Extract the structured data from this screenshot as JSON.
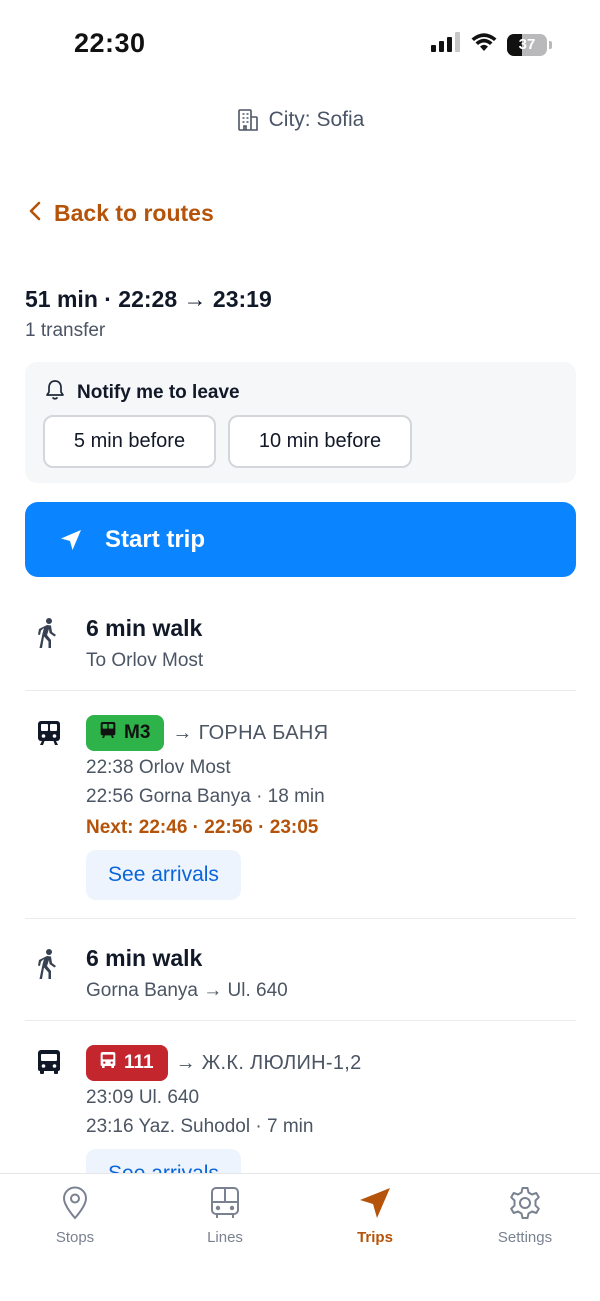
{
  "status_bar": {
    "time": "22:30",
    "battery": "37",
    "battery_level": 0.37
  },
  "header": {
    "city_label": "City: Sofia"
  },
  "back": {
    "label": "Back to routes"
  },
  "trip": {
    "summary": "51 min · 22:28 → 23:19",
    "transfers": "1 transfer"
  },
  "notify": {
    "title": "Notify me to leave",
    "options": [
      "5 min before",
      "10 min before"
    ]
  },
  "start": {
    "label": "Start trip"
  },
  "legs": [
    {
      "type": "walk",
      "title": "6 min walk",
      "subtitle": "To Orlov Most"
    },
    {
      "type": "metro",
      "line": "M3",
      "line_color": "#2eb24a",
      "destination": "→ ГОРНА БАНЯ",
      "departure": "22:38 Orlov Most",
      "arrival": "22:56 Gorna Banya · 18 min",
      "next": "Next: 22:46 · 22:56 · 23:05",
      "see_arrivals": "See arrivals"
    },
    {
      "type": "walk",
      "title": "6 min walk",
      "subtitle": "Gorna Banya → Ul. 640"
    },
    {
      "type": "bus",
      "line": "111",
      "line_color": "#c4262e",
      "destination": "→ Ж.К. ЛЮЛИН-1,2",
      "departure": "23:09 Ul. 640",
      "arrival": "23:16 Yaz. Suhodol · 7 min",
      "see_arrivals": "See arrivals"
    }
  ],
  "tabs": [
    {
      "label": "Stops",
      "icon": "map-pin-icon"
    },
    {
      "label": "Lines",
      "icon": "bus-icon"
    },
    {
      "label": "Trips",
      "icon": "navigation-icon",
      "active": true
    },
    {
      "label": "Settings",
      "icon": "gear-icon"
    }
  ],
  "colors": {
    "accent": "#b45309",
    "primary": "#0a84ff",
    "link": "#0a66d8"
  }
}
